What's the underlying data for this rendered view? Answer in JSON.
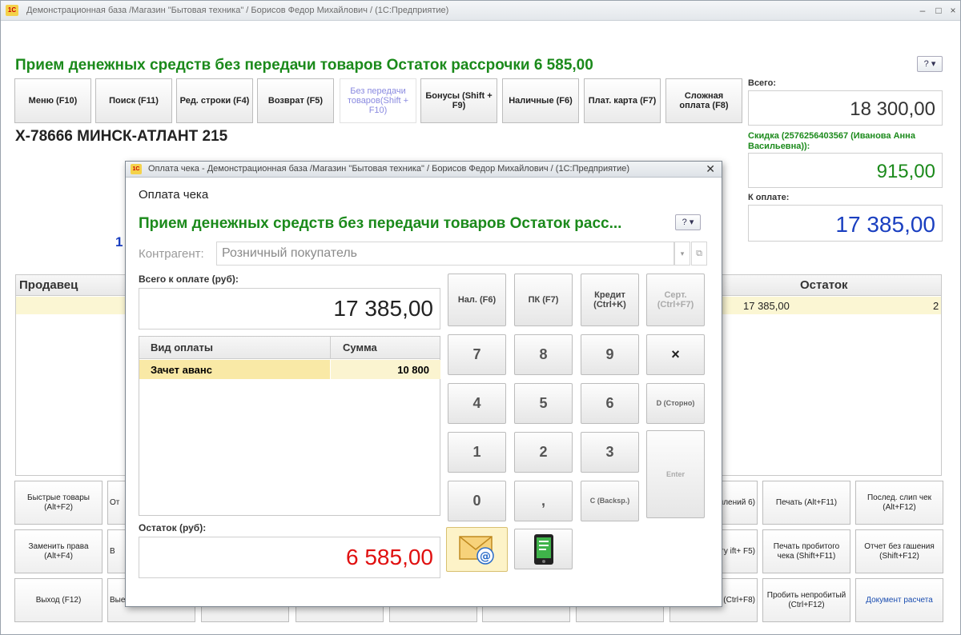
{
  "main_window": {
    "title": "Демонстрационная база /Магазин \"Бытовая техника\" / Борисов Федор Михайлович /  (1С:Предприятие)",
    "logo_text": "1С",
    "heading": "Прием денежных средств без передачи товаров Остаток рассрочки 6 585,00",
    "help_label": "?",
    "toolbar": [
      "Меню (F10)",
      "Поиск (F11)",
      "Ред. строки (F4)",
      "Возврат (F5)",
      "Без передачи товаров(Shift + F10)",
      "Бонусы (Shift + F9)",
      "Наличные (F6)",
      "Плат. карта (F7)",
      "Сложная оплата (F8)"
    ],
    "product_title": "Х-78666 МИНСК-АТЛАНТ 215",
    "blue_fragment": "1",
    "summary": {
      "total_label": "Всего:",
      "total_value": "18 300,00",
      "discount_label": "Скидка (2576256403567 (Иванова Анна Васильевна)):",
      "discount_value": "915,00",
      "topay_label": "К оплате:",
      "topay_value": "17 385,00"
    },
    "grid": {
      "col_seller": "Продавец",
      "col_rest": "Остаток",
      "row_amount": "17 385,00",
      "row_rest": "2"
    },
    "bottom_buttons": {
      "left": [
        "Быстрые товары (Alt+F2)",
        "Заменить права (Alt+F4)",
        "Выход (F12)"
      ],
      "left_partial": [
        "От",
        "В",
        "Вые"
      ],
      "right_partial": [
        "оплений 6)",
        "плату ift+ F5)",
        "н. (Ctrl+F8)"
      ],
      "mid": [
        "Печать (Alt+F11)",
        "Печать пробитого чека (Shift+F11)",
        "Пробить непробитый (Ctrl+F12)"
      ],
      "right": [
        "Послед. слип чек (Alt+F12)",
        "Отчет без гашения (Shift+F12)",
        "Документ расчета"
      ]
    }
  },
  "dialog": {
    "title": "Оплата чека - Демонстрационная база /Магазин \"Бытовая техника\" / Борисов Федор Михайлович /  (1С:Предприятие)",
    "subtitle": "Оплата чека",
    "heading": "Прием денежных средств без передачи товаров Остаток расс...",
    "contractor_label": "Контрагент:",
    "contractor_value": "Розничный покупатель",
    "total_label": "Всего к оплате (руб):",
    "total_value": "17 385,00",
    "table": {
      "col_type": "Вид оплаты",
      "col_sum": "Сумма",
      "rows": [
        {
          "type": "Зачет аванс",
          "sum": "10 800"
        }
      ]
    },
    "rest_label": "Остаток (руб):",
    "rest_value": "6 585,00",
    "keys": {
      "cash": "Нал. (F6)",
      "card": "ПК (F7)",
      "credit": "Кредит (Ctrl+K)",
      "cert": "Серт. (Ctrl+F7)",
      "k7": "7",
      "k8": "8",
      "k9": "9",
      "clear": "×",
      "k4": "4",
      "k5": "5",
      "k6": "6",
      "storno": "D (Сторно)",
      "k1": "1",
      "k2": "2",
      "k3": "3",
      "enter": "Enter",
      "k0": "0",
      "comma": ",",
      "backspace": "C (Backsp.)"
    }
  },
  "colors": {
    "green": "#1b8a1b",
    "blue": "#1a3fc0",
    "red": "#e01010",
    "row_highlight": "#fbf6d3"
  }
}
